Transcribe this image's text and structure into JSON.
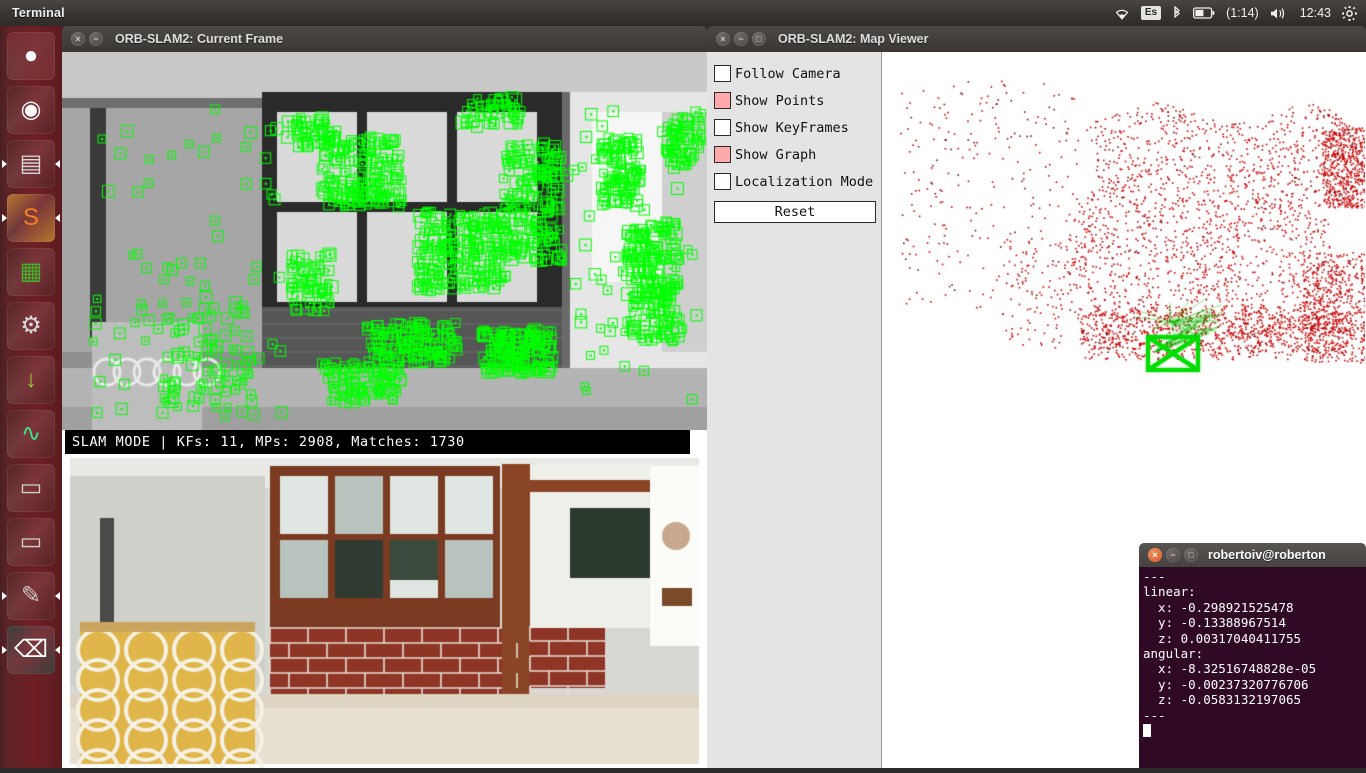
{
  "top_panel": {
    "title": "Terminal",
    "tray": {
      "wifi_icon": "wifi-icon",
      "keyboard_layout": "Es",
      "bluetooth_icon": "bluetooth-icon",
      "battery_icon": "battery-icon",
      "battery_time": "(1:14)",
      "volume_icon": "volume-icon",
      "clock": "12:43",
      "gear_icon": "gear-icon"
    }
  },
  "launcher": {
    "items": [
      {
        "name": "ubuntu-dash-icon",
        "glyph": "●",
        "bg": "#7a2b2e",
        "fg": "#ffffff",
        "running": false
      },
      {
        "name": "google-chrome-icon",
        "glyph": "◉",
        "bg": "#5a2326",
        "fg": "#ffffff",
        "running": false
      },
      {
        "name": "files-nautilus-icon",
        "glyph": "▤",
        "bg": "#5a2326",
        "fg": "#d8d8d8",
        "running": true
      },
      {
        "name": "sublime-text-icon",
        "glyph": "S",
        "bg": "#b8762e",
        "fg": "#f08020",
        "running": true
      },
      {
        "name": "libreoffice-calc-icon",
        "glyph": "▦",
        "bg": "#5a2326",
        "fg": "#43b02a",
        "running": false
      },
      {
        "name": "system-settings-icon",
        "glyph": "⚙",
        "bg": "#5a2326",
        "fg": "#d9d9d9",
        "running": false
      },
      {
        "name": "ubuntu-software-icon",
        "glyph": "↓",
        "bg": "#5a2326",
        "fg": "#9ccc3a",
        "running": false
      },
      {
        "name": "system-monitor-icon",
        "glyph": "∿",
        "bg": "#5a2326",
        "fg": "#40e080",
        "running": false
      },
      {
        "name": "disk-drive-icon",
        "glyph": "▭",
        "bg": "#5a2326",
        "fg": "#cfcfcf",
        "running": false
      },
      {
        "name": "disk-drive-2-icon",
        "glyph": "▭",
        "bg": "#5a2326",
        "fg": "#cfcfcf",
        "running": false
      },
      {
        "name": "text-editor-icon",
        "glyph": "✎",
        "bg": "#5a2326",
        "fg": "#c8c8c8",
        "running": true
      },
      {
        "name": "terminal-windows-stack-icon",
        "glyph": "⌫",
        "bg": "#3d3d3d",
        "fg": "#ffffff",
        "running": true
      }
    ]
  },
  "current_frame_window": {
    "title": "ORB-SLAM2: Current Frame",
    "buttons": {
      "close": "×",
      "minimize": "−"
    },
    "status_bar": "SLAM MODE |  KFs: 11, MPs: 2908, Matches: 1730",
    "status_fields": {
      "mode": "SLAM MODE",
      "keyframes": 11,
      "map_points": 2908,
      "matches": 1730
    },
    "keypoint_color": "#00ff00"
  },
  "map_viewer_window": {
    "title": "ORB-SLAM2: Map Viewer",
    "buttons": {
      "close": "×",
      "minimize": "−",
      "maximize": "□"
    },
    "checkboxes": [
      {
        "label": "Follow Camera",
        "checked": false
      },
      {
        "label": "Show Points",
        "checked": true
      },
      {
        "label": "Show KeyFrames",
        "checked": false
      },
      {
        "label": "Show Graph",
        "checked": true
      },
      {
        "label": "Localization Mode",
        "checked": false
      }
    ],
    "reset_label": "Reset",
    "checked_color": "#ffaaaa",
    "point_cloud_color": "#cc0000",
    "camera_frustum_color": "#00dd00"
  },
  "terminal_window": {
    "title": "robertoiv@roberton",
    "buttons": {
      "close": "×",
      "minimize": "−",
      "maximize": "□"
    },
    "output": "---\nlinear:\n  x: -0.298921525478\n  y: -0.13388967514\n  z: 0.00317040411755\nangular:\n  x: -8.32516748828e-05\n  y: -0.00237320776706\n  z: -0.0583132197065\n---"
  }
}
